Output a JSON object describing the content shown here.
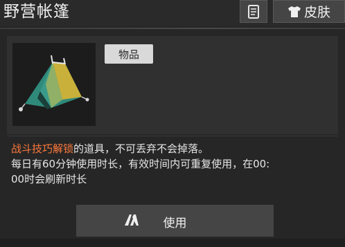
{
  "header": {
    "title": "野营帐篷",
    "skin_label": "皮肤"
  },
  "item": {
    "tag": "物品",
    "icon": "tent-icon"
  },
  "description": {
    "highlight": "战斗技巧解锁",
    "line1_rest": "的道具，不可丢弃不会掉落。",
    "line2": "每日有60分钟使用时长，有效时间内可重复使用，在00:",
    "line3": "00时会刷新时长"
  },
  "actions": {
    "use_label": "使用"
  },
  "colors": {
    "highlight": "#ff7a3c",
    "background": "#262626"
  }
}
